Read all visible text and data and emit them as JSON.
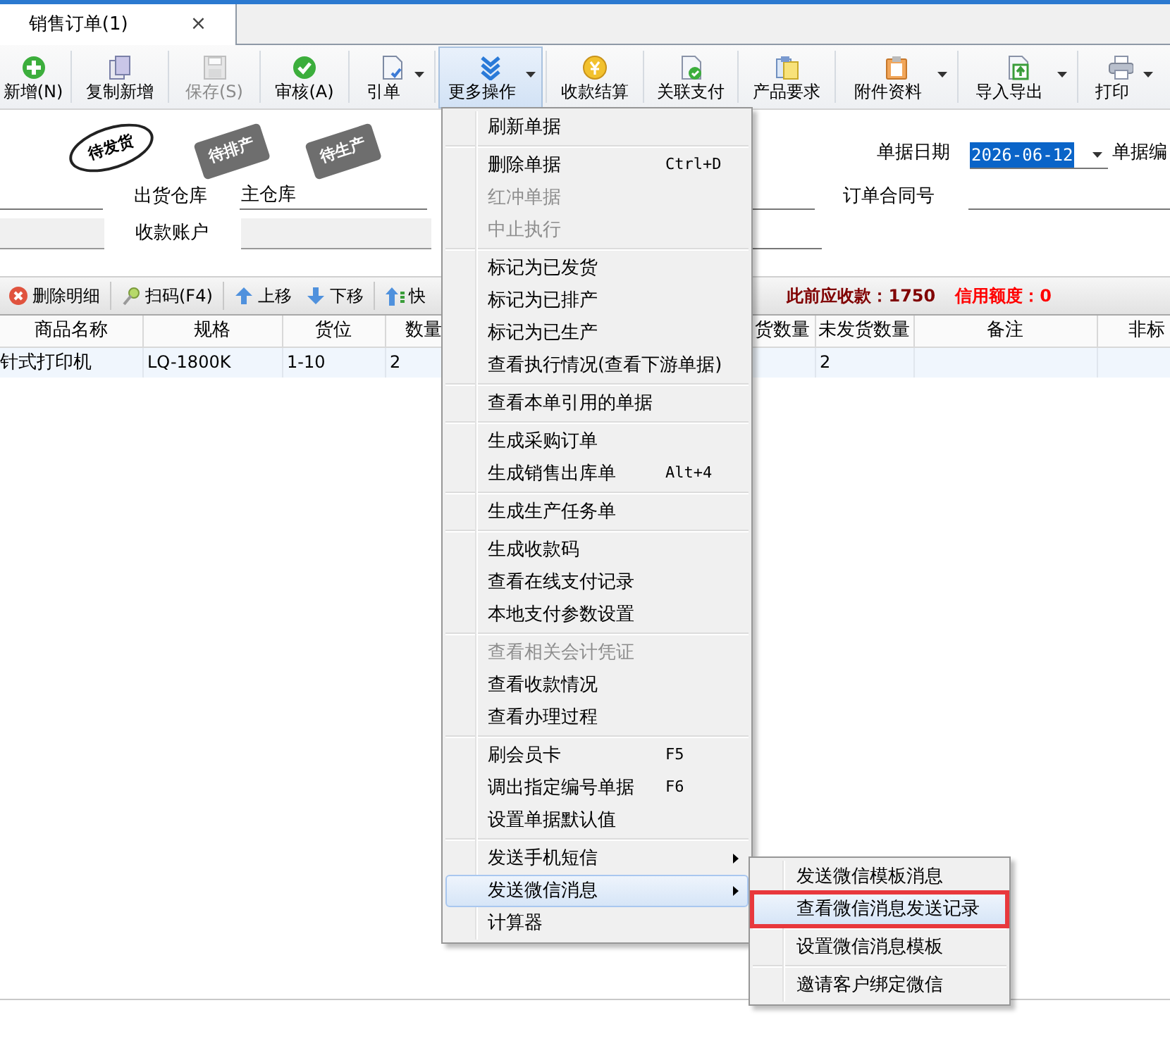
{
  "tabs": [
    {
      "label": "销售订单(1)",
      "close": "×",
      "selected": true
    }
  ],
  "toolbar": [
    {
      "label": "新增(N)",
      "disabled": false,
      "dropdown": false,
      "selected": false
    },
    {
      "label": "复制新增",
      "disabled": false,
      "dropdown": false,
      "selected": false
    },
    {
      "label": "保存(S)",
      "disabled": true,
      "dropdown": false,
      "selected": false
    },
    {
      "label": "审核(A)",
      "disabled": false,
      "dropdown": false,
      "selected": false
    },
    {
      "label": "引单",
      "disabled": false,
      "dropdown": true,
      "selected": false
    },
    {
      "label": "更多操作",
      "disabled": false,
      "dropdown": true,
      "selected": true
    },
    {
      "label": "收款结算",
      "disabled": false,
      "dropdown": false,
      "selected": false
    },
    {
      "label": "关联支付",
      "disabled": false,
      "dropdown": false,
      "selected": false
    },
    {
      "label": "产品要求",
      "disabled": false,
      "dropdown": false,
      "selected": false
    },
    {
      "label": "附件资料",
      "disabled": false,
      "dropdown": true,
      "selected": false
    },
    {
      "label": "导入导出",
      "disabled": false,
      "dropdown": true,
      "selected": false
    },
    {
      "label": "打印",
      "disabled": false,
      "dropdown": true,
      "selected": false
    }
  ],
  "stamps": [
    {
      "label": "待发货",
      "kind": "oval"
    },
    {
      "label": "待排产",
      "kind": "tag"
    },
    {
      "label": "待生产",
      "kind": "tag"
    }
  ],
  "date_field": {
    "label": "单据日期",
    "value": "2026-06-12"
  },
  "number_label": "单据编",
  "warehouse": {
    "label": "出货仓库",
    "value": "主仓库"
  },
  "account": {
    "label": "收款账户"
  },
  "contract": {
    "label": "订单合同号"
  },
  "detail_toolbar": [
    {
      "label": "删除明细"
    },
    {
      "label": "扫码(F4)"
    },
    {
      "label": "上移"
    },
    {
      "label": "下移"
    },
    {
      "label": "快"
    }
  ],
  "summary": [
    {
      "label": "此前应收款：1750",
      "color": "#800000"
    },
    {
      "label": "信用额度：0",
      "color": "#ff0000"
    }
  ],
  "table": {
    "columns": [
      "商品名称",
      "规格",
      "货位",
      "数量",
      "货数量",
      "未发货数量",
      "备注",
      "非标"
    ],
    "rows": [
      {
        "cells": [
          "针式打印机",
          "LQ-1800K",
          "1-10",
          "2",
          null,
          "2",
          null,
          null
        ]
      }
    ]
  },
  "more_menu": {
    "groups": [
      [
        {
          "label": "刷新单据",
          "disabled": false,
          "selected": false
        }
      ],
      [
        {
          "label": "删除单据",
          "shortcut": "Ctrl+D",
          "disabled": false,
          "selected": false
        },
        {
          "label": "红冲单据",
          "disabled": true,
          "selected": false
        },
        {
          "label": "中止执行",
          "disabled": true,
          "selected": false
        }
      ],
      [
        {
          "label": "标记为已发货",
          "disabled": false,
          "selected": false
        },
        {
          "label": "标记为已排产",
          "disabled": false,
          "selected": false
        },
        {
          "label": "标记为已生产",
          "disabled": false,
          "selected": false
        },
        {
          "label": "查看执行情况(查看下游单据)",
          "disabled": false,
          "selected": false
        }
      ],
      [
        {
          "label": "查看本单引用的单据",
          "disabled": false,
          "selected": false
        }
      ],
      [
        {
          "label": "生成采购订单",
          "disabled": false,
          "selected": false
        },
        {
          "label": "生成销售出库单",
          "shortcut": "Alt+4",
          "disabled": false,
          "selected": false
        }
      ],
      [
        {
          "label": "生成生产任务单",
          "disabled": false,
          "selected": false
        }
      ],
      [
        {
          "label": "生成收款码",
          "disabled": false,
          "selected": false
        },
        {
          "label": "查看在线支付记录",
          "disabled": false,
          "selected": false
        },
        {
          "label": "本地支付参数设置",
          "disabled": false,
          "selected": false
        }
      ],
      [
        {
          "label": "查看相关会计凭证",
          "disabled": true,
          "selected": false
        },
        {
          "label": "查看收款情况",
          "disabled": false,
          "selected": false
        },
        {
          "label": "查看办理过程",
          "disabled": false,
          "selected": false
        }
      ],
      [
        {
          "label": "刷会员卡",
          "shortcut": "F5",
          "disabled": false,
          "selected": false
        },
        {
          "label": "调出指定编号单据",
          "shortcut": "F6",
          "disabled": false,
          "selected": false
        },
        {
          "label": "设置单据默认值",
          "disabled": false,
          "selected": false
        }
      ],
      [
        {
          "label": "发送手机短信",
          "submenu": true,
          "disabled": false,
          "selected": false
        },
        {
          "label": "发送微信消息",
          "submenu": true,
          "disabled": false,
          "selected": true
        },
        {
          "label": "计算器",
          "disabled": false,
          "selected": false
        }
      ]
    ]
  },
  "submenu": {
    "groups": [
      [
        {
          "label": "发送微信模板消息",
          "selected": false,
          "outlined": false
        },
        {
          "label": "查看微信消息发送记录",
          "selected": true,
          "outlined": true
        }
      ],
      [
        {
          "label": "设置微信消息模板",
          "selected": false,
          "outlined": false
        }
      ],
      [
        {
          "label": "邀请客户绑定微信",
          "selected": false,
          "outlined": false
        }
      ]
    ]
  }
}
